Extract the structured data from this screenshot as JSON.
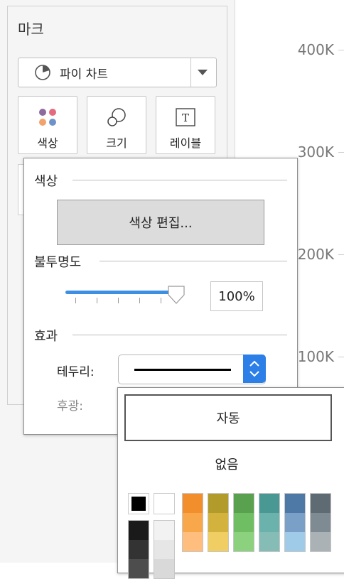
{
  "marks": {
    "title": "마크",
    "mark_type": "파이 차트",
    "properties": [
      {
        "label": "색상",
        "icon": "color-dots-icon"
      },
      {
        "label": "크기",
        "icon": "size-circles-icon"
      },
      {
        "label": "레이블",
        "icon": "text-T-icon"
      }
    ]
  },
  "axis": {
    "ticks": [
      "400K",
      "300K",
      "200K",
      "100K"
    ]
  },
  "color_popup": {
    "color_section": "색상",
    "edit_button": "색상 편집...",
    "opacity_section": "불투명도",
    "opacity_value": "100%",
    "opacity_fraction": 1.0,
    "effects_section": "효과",
    "border_label": "테두리:",
    "halo_label": "후광:",
    "slider_color": "#3d8fe3"
  },
  "border_palette": {
    "auto_label": "자동",
    "none_label": "없음",
    "basic": [
      "#000000",
      "#ffffff"
    ],
    "columns": [
      [
        "#f28e2b",
        "#f8a84a",
        "#ffbe7d"
      ],
      [
        "#b39b2b",
        "#d4b23e",
        "#f1ce63"
      ],
      [
        "#59a14f",
        "#6fbe63",
        "#8cd17d"
      ],
      [
        "#499894",
        "#6bb1ac",
        "#86bcb6"
      ],
      [
        "#4e79a7",
        "#7aa0c8",
        "#a0cbe8"
      ],
      [
        "#5f6b73",
        "#7f8b92",
        "#aab2b6"
      ]
    ],
    "grays": [
      "#1a1a1a",
      "#333333",
      "#4d4d4d"
    ],
    "lights": [
      "#f2f2f2",
      "#e6e6e6",
      "#d9d9d9"
    ]
  }
}
